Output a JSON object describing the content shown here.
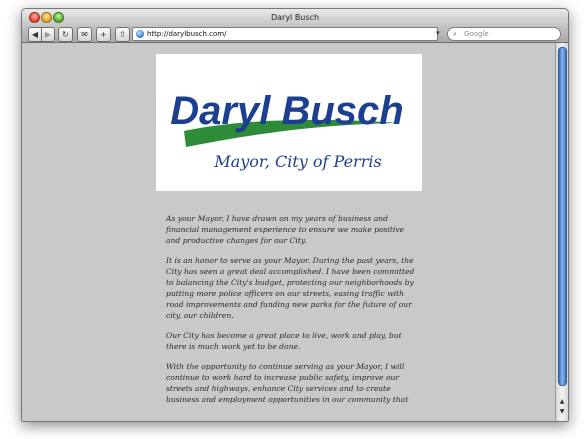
{
  "window": {
    "title": "Daryl Busch"
  },
  "toolbar": {
    "back_icon": "back-arrow-icon",
    "forward_icon": "forward-arrow-icon",
    "reload_icon": "reload-icon",
    "bookmark_icon": "bookmark-icon",
    "add_icon": "add-bookmark-icon",
    "share_icon": "share-icon",
    "url": "http://darylbusch.com/",
    "search_placeholder": "Google"
  },
  "logo": {
    "name": "Daryl Busch",
    "subtitle": "Mayor, City of Perris",
    "name_color": "#1d3f8f",
    "swoosh_color": "#2e8b3a"
  },
  "paragraphs": [
    "As your Mayor, I have drawn on my years of business and financial management experience to ensure we make positive and productive changes for our City.",
    "It is an honor to serve as your Mayor. During the past years, the City has seen a great deal accomplished. I have been committed to balancing the City's budget, protecting our neighborhoods by putting more police officers on our streets, easing traffic with road improvements and funding new parks for the future of our city, our children.",
    "Our City has become a great place to live, work and play, but there is much work yet to be done.",
    "With the opportunity to continue serving as your Mayor, I will continue to work hard to increase public safety, improve our streets and highways, enhance City services and to create business and employment opportunities in our community that"
  ]
}
